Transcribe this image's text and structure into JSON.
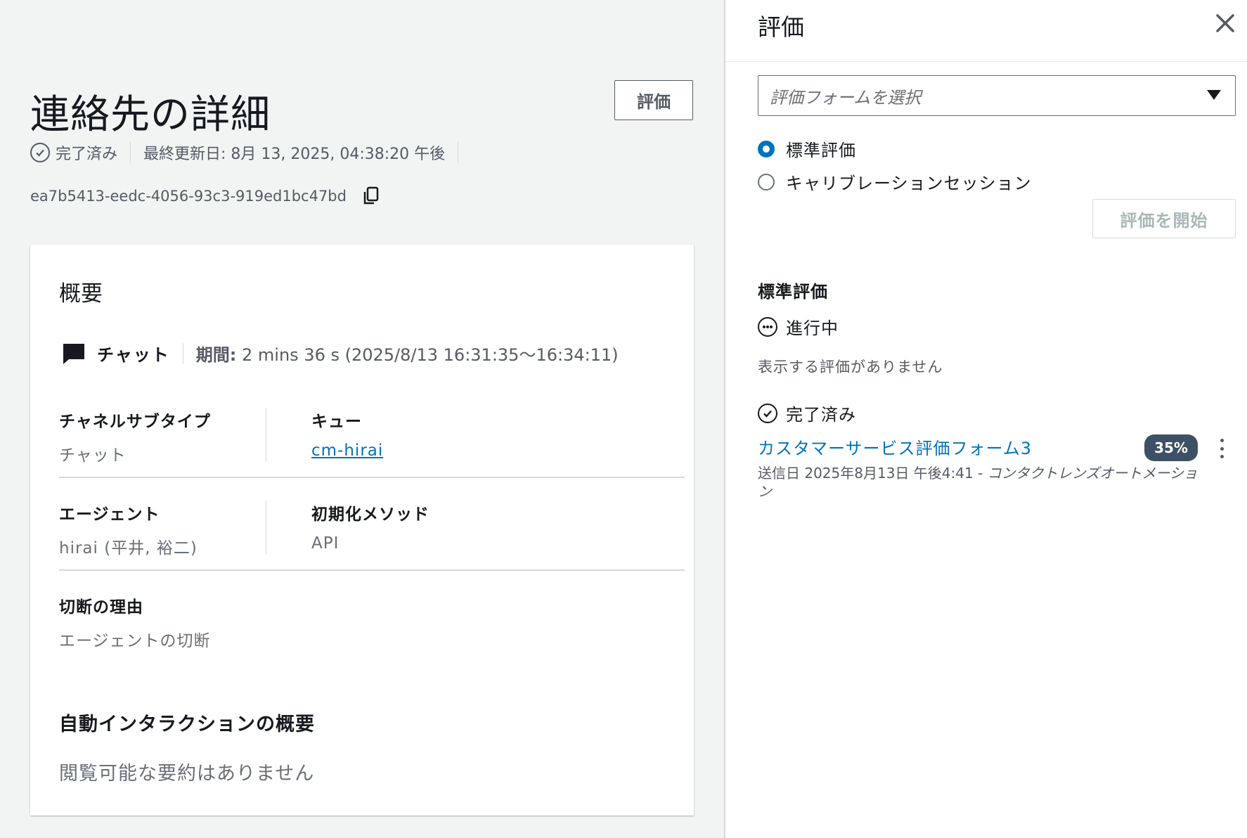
{
  "main": {
    "title": "連絡先の詳細",
    "evaluate_button": "評価",
    "status": "完了済み",
    "last_updated": "最終更新日: 8月 13, 2025, 04:38:20 午後",
    "contact_id": "ea7b5413-eedc-4056-93c3-919ed1bc47bd"
  },
  "overview": {
    "title": "概要",
    "channel": "チャット",
    "duration_label": "期間:",
    "duration_value": "2 mins 36 s (2025/8/13 16:31:35〜16:34:11)",
    "fields": {
      "channel_subtype_label": "チャネルサブタイプ",
      "channel_subtype_value": "チャット",
      "queue_label": "キュー",
      "queue_value": "cm-hirai",
      "agent_label": "エージェント",
      "agent_value": "hirai (平井, 裕二)",
      "init_method_label": "初期化メソッド",
      "init_method_value": "API",
      "disconnect_reason_label": "切断の理由",
      "disconnect_reason_value": "エージェントの切断"
    },
    "auto_interaction_title": "自動インタラクションの概要",
    "auto_interaction_empty": "閲覧可能な要約はありません"
  },
  "panel": {
    "title": "評価",
    "select_placeholder": "評価フォームを選択",
    "radio_standard": "標準評価",
    "radio_calibration": "キャリブレーションセッション",
    "start_button": "評価を開始",
    "section_title": "標準評価",
    "in_progress_label": "進行中",
    "in_progress_empty": "表示する評価がありません",
    "completed_label": "完了済み",
    "completed_item": {
      "form_name": "カスタマーサービス評価フォーム3",
      "score": "35%",
      "submitted_prefix": "送信日 2025年8月13日 午後4:41 - ",
      "submitted_by": "コンタクトレンズオートメーション"
    }
  },
  "icons": {
    "check": "check-circle-icon",
    "copy": "copy-icon",
    "chat": "chat-bubble-icon",
    "close": "close-icon",
    "caret": "caret-down-icon",
    "in_progress": "ellipsis-circle-icon",
    "kebab": "more-vertical-icon",
    "drag": "drag-handle-icon"
  },
  "colors": {
    "link": "#0073bb",
    "badge": "#3d5166",
    "radio_selected": "#0073bb"
  }
}
